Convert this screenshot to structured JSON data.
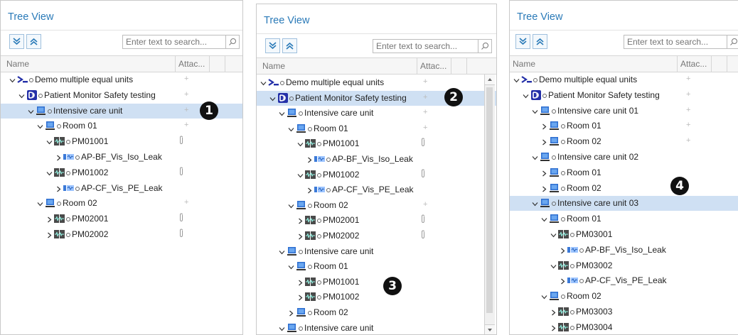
{
  "panels": [
    {
      "title": "Tree View",
      "search_placeholder": "Enter text to search...",
      "col_name": "Name",
      "col_attach": "Attac...",
      "badge": "1",
      "rows": [
        {
          "depth": 0,
          "toggle": "expanded",
          "icon": "demo-units",
          "label": "Demo multiple equal units",
          "plus": "+"
        },
        {
          "depth": 1,
          "toggle": "expanded",
          "icon": "safety-test",
          "label": "Patient Monitor Safety testing",
          "plus": "+"
        },
        {
          "depth": 2,
          "toggle": "expanded",
          "icon": "location",
          "label": "Intensive care unit",
          "plus": "+",
          "selected": true
        },
        {
          "depth": 3,
          "toggle": "expanded",
          "icon": "location",
          "label": "Room 01",
          "plus": "+"
        },
        {
          "depth": 4,
          "toggle": "expanded",
          "icon": "device",
          "label": "PM01001",
          "attach": true
        },
        {
          "depth": 5,
          "toggle": "collapsed",
          "icon": "procedure",
          "label": "AP-BF_Vis_Iso_Leak"
        },
        {
          "depth": 4,
          "toggle": "expanded",
          "icon": "device",
          "label": "PM01002",
          "attach": true
        },
        {
          "depth": 5,
          "toggle": "collapsed",
          "icon": "procedure",
          "label": "AP-CF_Vis_PE_Leak"
        },
        {
          "depth": 3,
          "toggle": "expanded",
          "icon": "location",
          "label": "Room 02",
          "plus": "+"
        },
        {
          "depth": 4,
          "toggle": "collapsed",
          "icon": "device",
          "label": "PM02001",
          "attach": true
        },
        {
          "depth": 4,
          "toggle": "collapsed",
          "icon": "device",
          "label": "PM02002",
          "attach": true
        }
      ]
    },
    {
      "title": "Tree View",
      "search_placeholder": "Enter text to search...",
      "col_name": "Name",
      "col_attach": "Attac...",
      "badge": "2",
      "badge2": "3",
      "rows": [
        {
          "depth": 0,
          "toggle": "expanded",
          "icon": "demo-units",
          "label": "Demo multiple equal units",
          "plus": "+"
        },
        {
          "depth": 1,
          "toggle": "expanded",
          "icon": "safety-test",
          "label": "Patient Monitor Safety testing",
          "plus": "+",
          "selected": true
        },
        {
          "depth": 2,
          "toggle": "expanded",
          "icon": "location",
          "label": "Intensive care unit",
          "plus": "+"
        },
        {
          "depth": 3,
          "toggle": "expanded",
          "icon": "location",
          "label": "Room 01",
          "plus": "+"
        },
        {
          "depth": 4,
          "toggle": "expanded",
          "icon": "device",
          "label": "PM01001",
          "attach": true
        },
        {
          "depth": 5,
          "toggle": "collapsed",
          "icon": "procedure",
          "label": "AP-BF_Vis_Iso_Leak"
        },
        {
          "depth": 4,
          "toggle": "expanded",
          "icon": "device",
          "label": "PM01002",
          "attach": true
        },
        {
          "depth": 5,
          "toggle": "collapsed",
          "icon": "procedure",
          "label": "AP-CF_Vis_PE_Leak"
        },
        {
          "depth": 3,
          "toggle": "expanded",
          "icon": "location",
          "label": "Room 02",
          "plus": "+"
        },
        {
          "depth": 4,
          "toggle": "collapsed",
          "icon": "device",
          "label": "PM02001",
          "attach": true
        },
        {
          "depth": 4,
          "toggle": "collapsed",
          "icon": "device",
          "label": "PM02002",
          "attach": true
        },
        {
          "depth": 2,
          "toggle": "expanded",
          "icon": "location",
          "label": "Intensive care unit"
        },
        {
          "depth": 3,
          "toggle": "expanded",
          "icon": "location",
          "label": "Room 01"
        },
        {
          "depth": 4,
          "toggle": "collapsed",
          "icon": "device",
          "label": "PM01001"
        },
        {
          "depth": 4,
          "toggle": "collapsed",
          "icon": "device",
          "label": "PM01002"
        },
        {
          "depth": 3,
          "toggle": "collapsed",
          "icon": "location",
          "label": "Room 02"
        },
        {
          "depth": 2,
          "toggle": "expanded",
          "icon": "location",
          "label": "Intensive care unit"
        }
      ]
    },
    {
      "title": "Tree View",
      "search_placeholder": "Enter text to search...",
      "col_name": "Name",
      "col_attach": "Attac...",
      "badge": "4",
      "rows": [
        {
          "depth": 0,
          "toggle": "expanded",
          "icon": "demo-units",
          "label": "Demo multiple equal units",
          "plus": "+"
        },
        {
          "depth": 1,
          "toggle": "expanded",
          "icon": "safety-test",
          "label": "Patient Monitor Safety testing",
          "plus": "+"
        },
        {
          "depth": 2,
          "toggle": "expanded",
          "icon": "location",
          "label": "Intensive care unit 01",
          "plus": "+"
        },
        {
          "depth": 3,
          "toggle": "collapsed",
          "icon": "location",
          "label": "Room 01",
          "plus": "+"
        },
        {
          "depth": 3,
          "toggle": "collapsed",
          "icon": "location",
          "label": "Room 02",
          "plus": "+"
        },
        {
          "depth": 2,
          "toggle": "expanded",
          "icon": "location",
          "label": "Intensive care unit 02"
        },
        {
          "depth": 3,
          "toggle": "collapsed",
          "icon": "location",
          "label": "Room 01"
        },
        {
          "depth": 3,
          "toggle": "collapsed",
          "icon": "location",
          "label": "Room 02"
        },
        {
          "depth": 2,
          "toggle": "expanded",
          "icon": "location",
          "label": "Intensive care unit 03",
          "selected": true
        },
        {
          "depth": 3,
          "toggle": "expanded",
          "icon": "location",
          "label": "Room 01"
        },
        {
          "depth": 4,
          "toggle": "expanded",
          "icon": "device",
          "label": "PM03001"
        },
        {
          "depth": 5,
          "toggle": "collapsed",
          "icon": "procedure",
          "label": "AP-BF_Vis_Iso_Leak"
        },
        {
          "depth": 4,
          "toggle": "expanded",
          "icon": "device",
          "label": "PM03002"
        },
        {
          "depth": 5,
          "toggle": "collapsed",
          "icon": "procedure",
          "label": "AP-CF_Vis_PE_Leak"
        },
        {
          "depth": 3,
          "toggle": "expanded",
          "icon": "location",
          "label": "Room 02"
        },
        {
          "depth": 4,
          "toggle": "collapsed",
          "icon": "device",
          "label": "PM03003"
        },
        {
          "depth": 4,
          "toggle": "collapsed",
          "icon": "device",
          "label": "PM03004"
        }
      ]
    }
  ],
  "colors": {
    "title": "#2a7ab8",
    "selection": "#cfe0f3",
    "location_icon": "#2f6fd0",
    "safety_icon": "#2430a8",
    "demo_icon": "#2430a8"
  }
}
